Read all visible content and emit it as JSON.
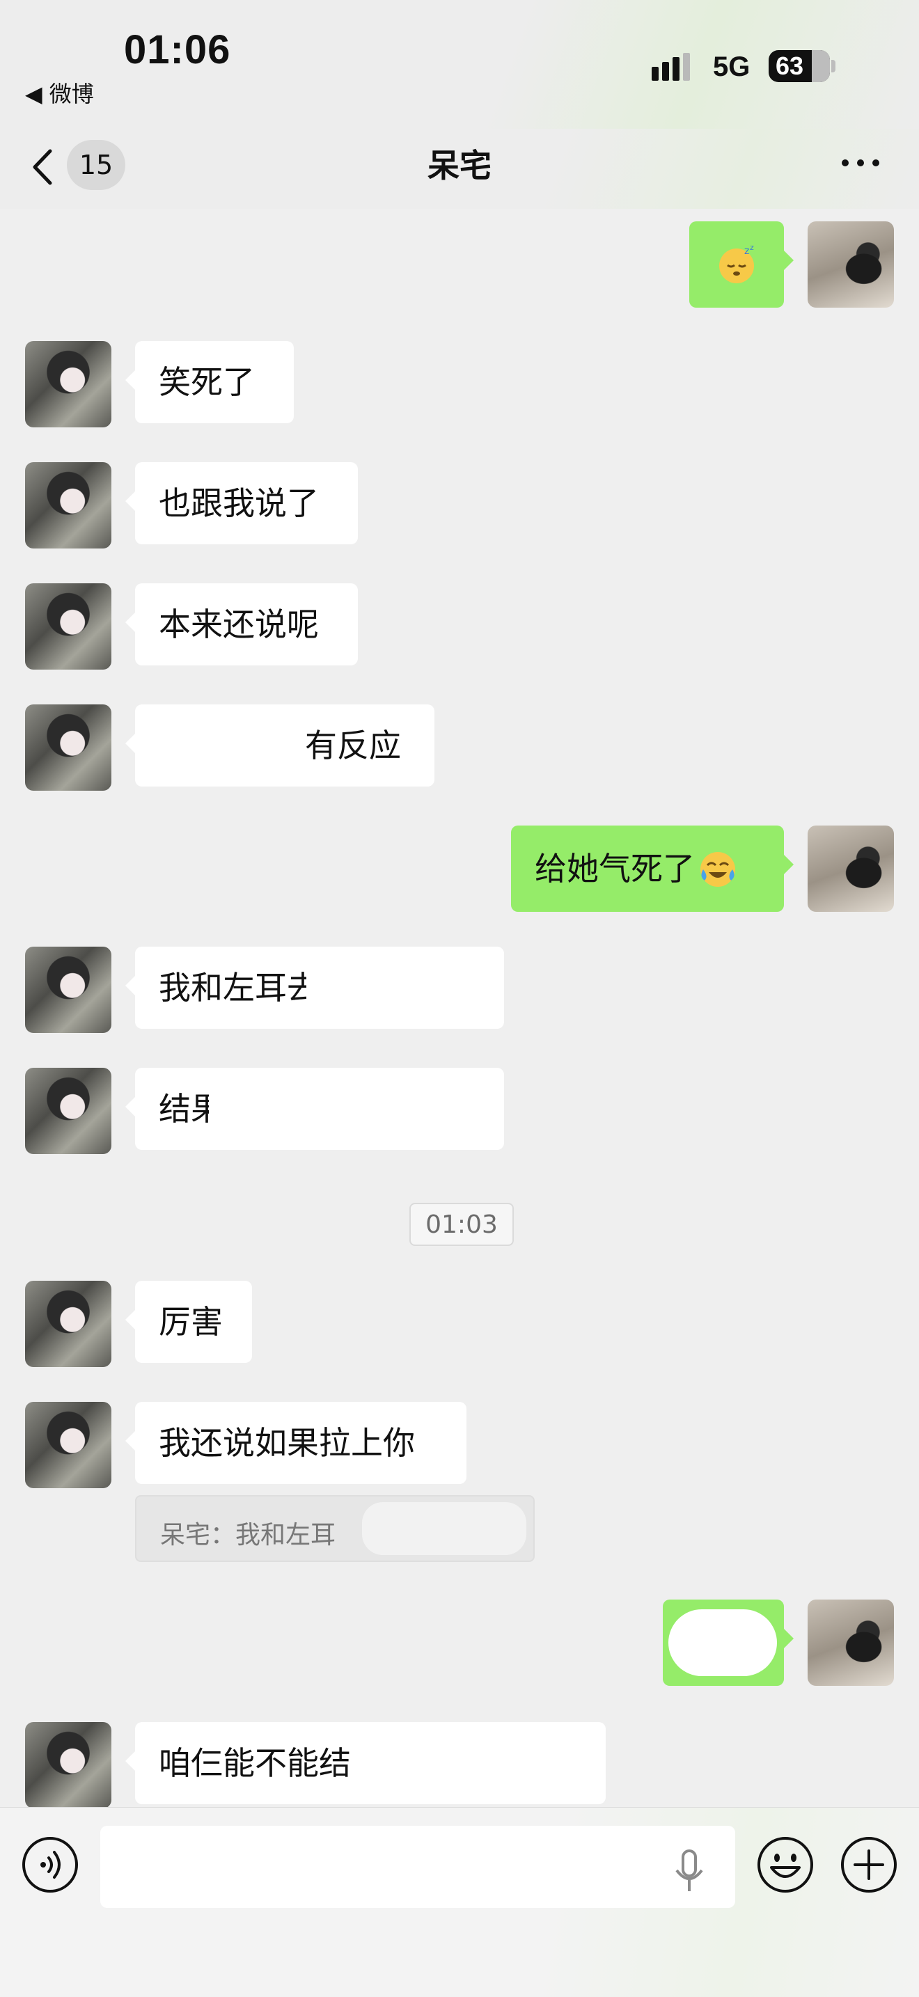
{
  "status_bar": {
    "time": "01:06",
    "back_app": "◀ 微博",
    "network": "5G",
    "battery": "63"
  },
  "nav": {
    "unread_count": "15",
    "title": "呆宅"
  },
  "messages": {
    "m2": "笑死了",
    "m3": "也跟我说了",
    "m4": "本来还说呢",
    "m5": "有反应",
    "m6": "给她气死了",
    "m7": "我和左耳去",
    "m8": "结果",
    "m9": "厉害",
    "m10": "我还说如果拉上你",
    "m10_quote": "呆宅：我和左耳",
    "m12": "咱仨能不能结"
  },
  "timestamp": "01:03"
}
